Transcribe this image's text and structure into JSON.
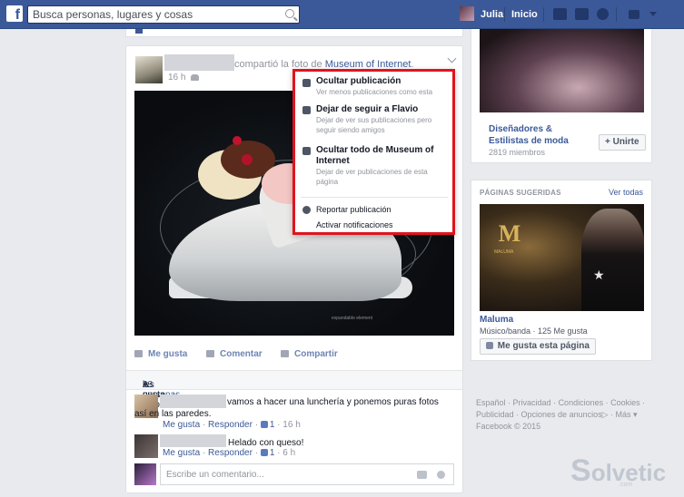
{
  "topbar": {
    "search_placeholder": "Busca personas, lugares y cosas",
    "user_name": "Julia",
    "home_label": "Inicio"
  },
  "post": {
    "header_text": "compartió la foto de",
    "page_link": "Museum of Internet",
    "header_period": ".",
    "time": "16 h",
    "photo_caption": "expandable element",
    "actions": {
      "like": "Me gusta",
      "comment": "Comentar",
      "share": "Compartir"
    },
    "likes": {
      "prefix": "A",
      "link": "13 personas",
      "suffix": "les gusta esto."
    },
    "comments": [
      {
        "text": "vamos a hacer una lunchería y ponemos puras fotos así en las paredes.",
        "like": "Me gusta",
        "reply": "Responder",
        "like_count": "1",
        "time": "16 h"
      },
      {
        "text": "Helado con queso!",
        "like": "Me gusta",
        "reply": "Responder",
        "like_count": "1",
        "time": "6 h"
      }
    ],
    "comment_placeholder": "Escribe un comentario..."
  },
  "menu": {
    "hide": {
      "title": "Ocultar publicación",
      "sub": "Ver menos publicaciones como esta"
    },
    "unfollow": {
      "title": "Dejar de seguir a Flavio",
      "sub": "Dejar de ver sus publicaciones pero seguir siendo amigos"
    },
    "hide_all": {
      "title": "Ocultar todo de Museum of Internet",
      "sub": "Dejar de ver publicaciones de esta página"
    },
    "report": "Reportar publicación",
    "notify": "Activar notificaciones"
  },
  "sidebar": {
    "group": {
      "name": "Diseñadores & Estilistas de moda",
      "members": "2819 miembros",
      "join": "+ Unirte"
    },
    "suggested": {
      "title": "PÁGINAS SUGERIDAS",
      "see_all": "Ver todas",
      "page_name": "Maluma",
      "page_info": "Músico/banda · 125 Me gusta",
      "like_button": "Me gusta esta página",
      "photo_text": "MALUMA"
    },
    "footer": {
      "links": [
        "Español",
        "Privacidad",
        "Condiciones",
        "Cookies",
        "Publicidad",
        "Opciones de anuncios",
        "Más"
      ],
      "copyright": "Facebook © 2015"
    }
  },
  "watermark": {
    "brand": "olvetic",
    "domain": ".com"
  },
  "colors": {
    "brand_blue": "#3b5998",
    "highlight_red": "#e0141e"
  }
}
